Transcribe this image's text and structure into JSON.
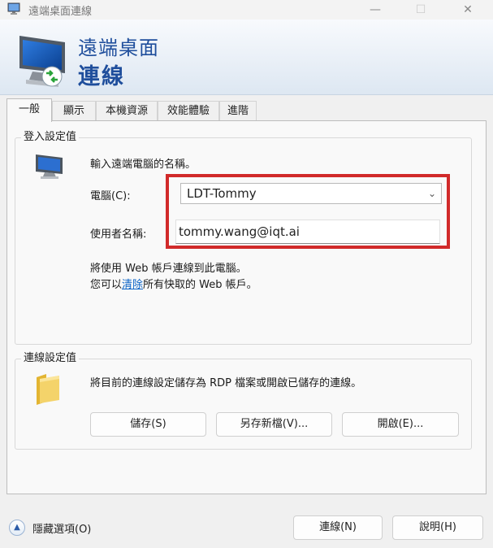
{
  "window": {
    "title": "遠端桌面連線",
    "minimize": "—",
    "maximize": "☐",
    "close": "✕"
  },
  "banner": {
    "line1": "遠端桌面",
    "line2": "連線"
  },
  "tabs": [
    "一般",
    "顯示",
    "本機資源",
    "效能體驗",
    "進階"
  ],
  "logon_group": {
    "title": "登入設定值",
    "instruction": "輸入遠端電腦的名稱。",
    "computer_label": "電腦(C):",
    "computer_value": "LDT-Tommy",
    "username_label": "使用者名稱:",
    "username_value": "tommy.wang@iqt.ai",
    "note_line1": "將使用 Web 帳戶連線到此電腦。",
    "note_line2_pre": "您可以",
    "note_line2_link": "清除",
    "note_line2_post": "所有快取的 Web 帳戶。"
  },
  "connection_group": {
    "title": "連線設定值",
    "description": "將目前的連線設定儲存為 RDP 檔案或開啟已儲存的連線。",
    "save_button": "儲存(S)",
    "save_as_button": "另存新檔(V)...",
    "open_button": "開啟(E)..."
  },
  "footer": {
    "hide_options": "隱藏選項(O)",
    "connect_button": "連線(N)",
    "help_button": "說明(H)"
  },
  "colors": {
    "banner_text": "#1f4e9c",
    "highlight": "#d12a2a",
    "link": "#0b63c6"
  }
}
